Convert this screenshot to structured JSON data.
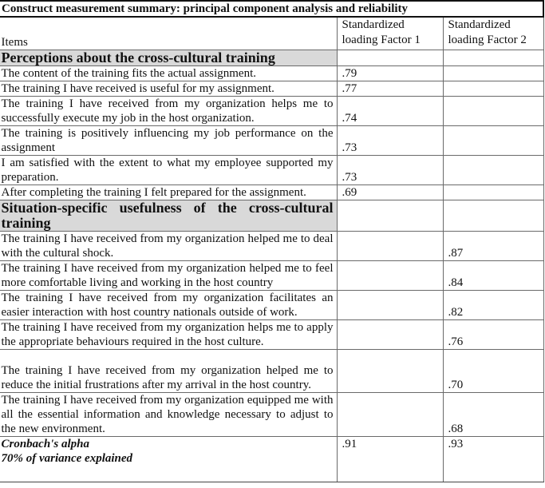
{
  "table": {
    "title": "Construct measurement summary: principal component analysis and reliability",
    "columns": {
      "items": "Items",
      "factor1": "Standardized loading Factor 1",
      "factor2": "Standardized loading Factor 2"
    },
    "sections": [
      {
        "label": "Perceptions about the cross-cultural training",
        "rows": [
          {
            "item": "The content of the training fits the actual assignment.",
            "factor1": ".79",
            "factor2": ""
          },
          {
            "item": "The training I have received is useful for my assignment.",
            "factor1": ".77",
            "factor2": ""
          },
          {
            "item": "The training I have received from my organization helps me to successfully execute my job in the host organization.",
            "factor1": ".74",
            "factor2": ""
          },
          {
            "item": "The training is positively influencing my job performance on the assignment",
            "factor1": ".73",
            "factor2": ""
          },
          {
            "item": "I am satisfied with the extent to what my employee supported my preparation.",
            "factor1": ".73",
            "factor2": ""
          },
          {
            "item": "After completing the training I felt prepared for the assignment.",
            "factor1": ".69",
            "factor2": ""
          }
        ]
      },
      {
        "label": "Situation-specific usefulness of the cross-cultural training",
        "rows": [
          {
            "item": "The training I have received from my organization helped me to deal with the cultural shock.",
            "factor1": "",
            "factor2": ".87"
          },
          {
            "item": "The training I have received from my organization helped me to feel more comfortable living and working in the host country",
            "factor1": "",
            "factor2": ".84"
          },
          {
            "item": "The training I have received from my organization facilitates an easier interaction with host country nationals outside of work.",
            "factor1": "",
            "factor2": ".82"
          },
          {
            "item": "The training I have received from my organization helps me to apply the appropriate behaviours required in the host culture.",
            "factor1": "",
            "factor2": ".76"
          },
          {
            "item": "The training I have received from my organization helped me to reduce the initial frustrations after my arrival in the host country.",
            "factor1": "",
            "factor2": ".70"
          },
          {
            "item": "The training I have received from my organization equipped me with all the essential information and knowledge necessary to adjust to the new environment.",
            "factor1": "",
            "factor2": ".68"
          }
        ]
      }
    ],
    "footer": {
      "alpha_label": "Cronbach's alpha",
      "variance_label": "70% of variance explained",
      "factor1_alpha": ".91",
      "factor2_alpha": ".93"
    }
  }
}
